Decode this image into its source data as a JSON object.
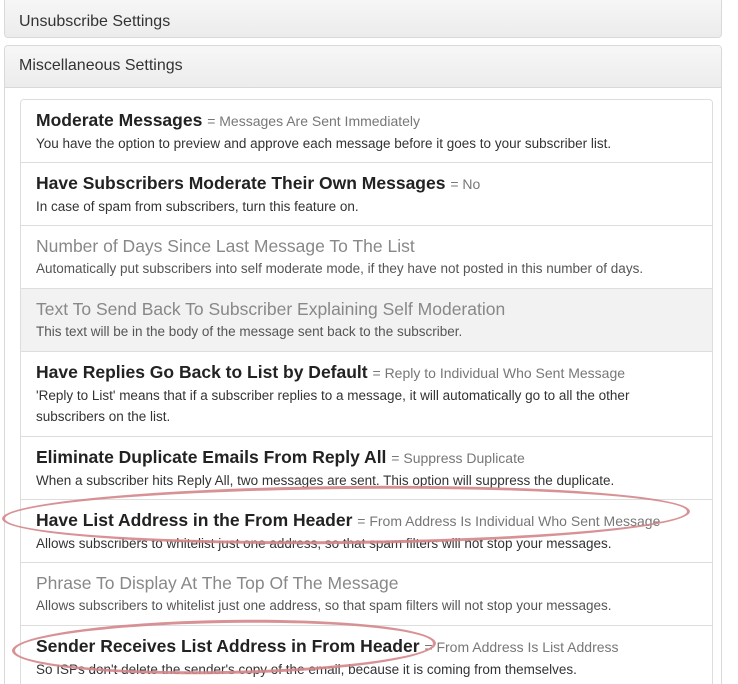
{
  "panels": {
    "unsubscribe_title": "Unsubscribe Settings",
    "misc_title": "Miscellaneous Settings"
  },
  "settings": [
    {
      "title": "Moderate Messages",
      "value": "= Messages Are Sent Immediately",
      "desc": "You have the option to preview and approve each message before it goes to your subscriber list."
    },
    {
      "title": "Have Subscribers Moderate Their Own Messages",
      "value": "= No",
      "desc": "In case of spam from subscribers, turn this feature on."
    },
    {
      "title": "Number of Days Since Last Message To The List",
      "value": "",
      "desc": "Automatically put subscribers into self moderate mode, if they have not posted in this number of days."
    },
    {
      "title": "Text To Send Back To Subscriber Explaining Self Moderation",
      "value": "",
      "desc": "This text will be in the body of the message sent back to the subscriber."
    },
    {
      "title": "Have Replies Go Back to List by Default",
      "value": "= Reply to Individual Who Sent Message",
      "desc": "'Reply to List' means that if a subscriber replies to a message, it will automatically go to all the other subscribers on the list."
    },
    {
      "title": "Eliminate Duplicate Emails From Reply All",
      "value": "= Suppress Duplicate",
      "desc": "When a subscriber hits Reply All, two messages are sent. This option will suppress the duplicate."
    },
    {
      "title": "Have List Address in the From Header",
      "value": "= From Address Is Individual Who Sent Message",
      "desc": "Allows subscribers to whitelist just one address, so that spam filters will not stop your messages."
    },
    {
      "title": "Phrase To Display At The Top Of The Message",
      "value": "",
      "desc": "Allows subscribers to whitelist just one address, so that spam filters will not stop your messages."
    },
    {
      "title": "Sender Receives List Address in From Header",
      "value": "= From Address Is List Address",
      "desc": "So ISPs don't delete the sender's copy of the email, because it is coming from themselves."
    }
  ],
  "annotation_color": "#d4868a"
}
